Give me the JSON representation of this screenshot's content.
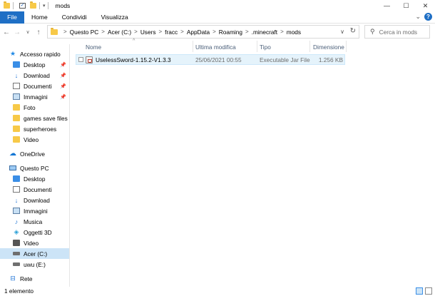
{
  "window": {
    "title": "mods",
    "controls": {
      "minimize": "—",
      "maximize": "☐",
      "close": "✕"
    }
  },
  "ribbon": {
    "tabs": [
      "File",
      "Home",
      "Condividi",
      "Visualizza"
    ],
    "expand_icon": "chevron-down-icon",
    "help_label": "?"
  },
  "navigation": {
    "back": "←",
    "forward": "→",
    "recent": "∨",
    "up": "↑",
    "breadcrumb": [
      "Questo PC",
      "Acer (C:)",
      "Users",
      "fracc",
      "AppData",
      "Roaming",
      ".minecraft",
      "mods"
    ],
    "separator": ">",
    "search_placeholder": "Cerca in mods"
  },
  "sidebar": {
    "quick_access": {
      "label": "Accesso rapido",
      "items": [
        {
          "label": "Desktop",
          "pinned": true
        },
        {
          "label": "Download",
          "pinned": true
        },
        {
          "label": "Documenti",
          "pinned": true
        },
        {
          "label": "Immagini",
          "pinned": true
        },
        {
          "label": "Foto",
          "pinned": false
        },
        {
          "label": "games save files",
          "pinned": false
        },
        {
          "label": "superheroes",
          "pinned": false
        },
        {
          "label": "Video",
          "pinned": false
        }
      ]
    },
    "onedrive": {
      "label": "OneDrive"
    },
    "this_pc": {
      "label": "Questo PC",
      "items": [
        {
          "label": "Desktop"
        },
        {
          "label": "Documenti"
        },
        {
          "label": "Download"
        },
        {
          "label": "Immagini"
        },
        {
          "label": "Musica"
        },
        {
          "label": "Oggetti 3D"
        },
        {
          "label": "Video"
        },
        {
          "label": "Acer (C:)",
          "selected": true
        },
        {
          "label": "uwu (E:)"
        }
      ]
    },
    "network": {
      "label": "Rete"
    }
  },
  "file_list": {
    "columns": [
      "Nome",
      "Ultima modifica",
      "Tipo",
      "Dimensione"
    ],
    "sort_indicator": "^",
    "rows": [
      {
        "name": "UselessSword-1.15.2-V1.3.3",
        "modified": "25/06/2021 00:55",
        "type": "Executable Jar File",
        "size": "1.256 KB"
      }
    ]
  },
  "status_bar": {
    "item_count": "1 elemento"
  },
  "colors": {
    "accent": "#1f6fc5",
    "selection": "#cce4f7",
    "row_hover": "#e5f3fb",
    "header_text": "#4c607a"
  }
}
